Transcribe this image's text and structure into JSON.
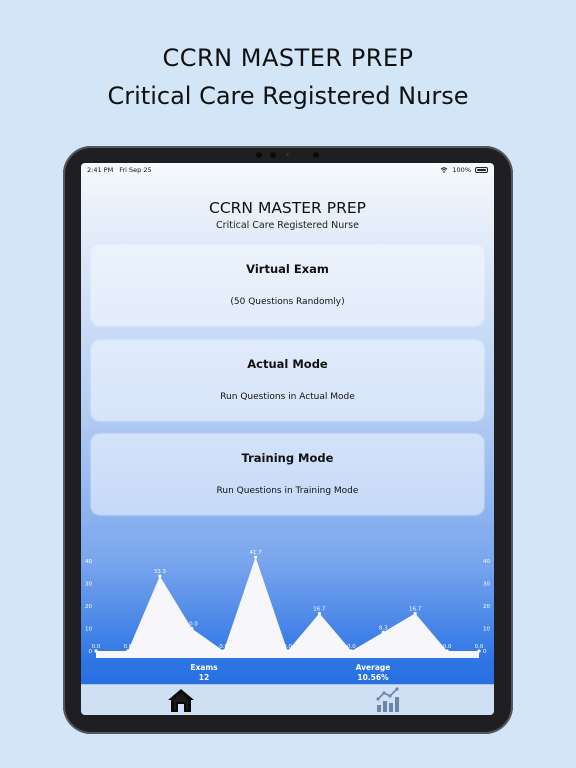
{
  "promo": {
    "title": "CCRN MASTER PREP",
    "subtitle": "Critical Care Registered Nurse"
  },
  "status_bar": {
    "time": "2:41 PM",
    "date": "Fri Sep 25",
    "battery": "100%"
  },
  "app": {
    "title": "CCRN MASTER PREP",
    "subtitle": "Critical Care Registered Nurse"
  },
  "cards": [
    {
      "title": "Virtual Exam",
      "description": "(50 Questions Randomly)"
    },
    {
      "title": "Actual Mode",
      "description": "Run Questions in Actual Mode"
    },
    {
      "title": "Training Mode",
      "description": "Run Questions in Training Mode"
    }
  ],
  "chart_data": {
    "type": "area",
    "values": [
      0.0,
      0.0,
      33.3,
      10.0,
      0.0,
      41.7,
      0.0,
      16.7,
      0.0,
      8.3,
      16.7,
      0.0,
      0.0
    ],
    "value_labels": [
      "0.0",
      "0.0",
      "33.3",
      "10.0",
      "0.0",
      "41.7",
      "0.0",
      "16.7",
      "0.0",
      "8.3",
      "16.7",
      "0.0",
      "0.0"
    ],
    "y_ticks": [
      "40",
      "30",
      "20",
      "10",
      "0"
    ],
    "ylim": [
      0,
      40
    ],
    "grid": false,
    "fill_color": "#f7f7fb"
  },
  "stats": {
    "exams_label": "Exams",
    "exams_value": "12",
    "average_label": "Average",
    "average_value": "10.56%"
  },
  "tabbar": {
    "items": [
      {
        "icon": "home-icon",
        "selected": true
      },
      {
        "icon": "stats-chart-icon",
        "selected": false
      }
    ]
  },
  "colors": {
    "background": "#d3e6f7",
    "chart_fill": "#f7f7fb",
    "accent": "#1d66df"
  }
}
